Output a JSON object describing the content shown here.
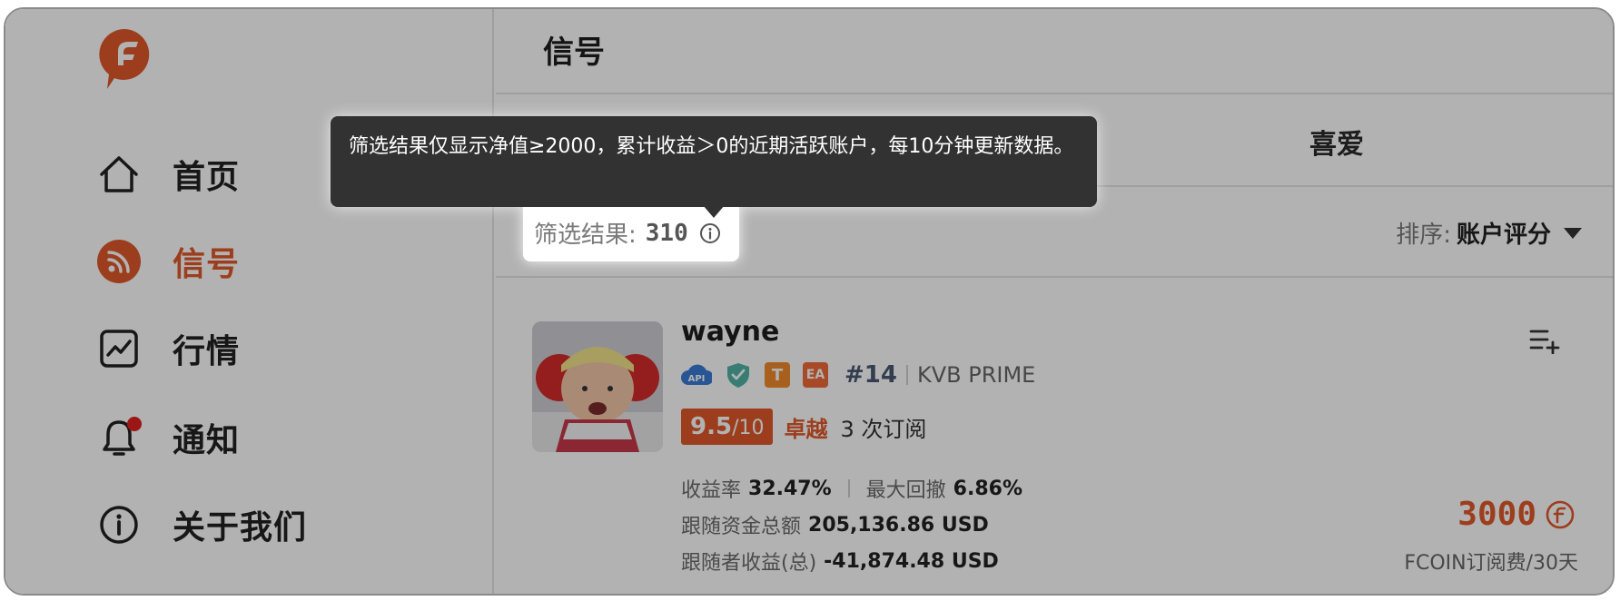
{
  "sidebar": {
    "items": [
      {
        "label": "首页",
        "icon": "home-icon"
      },
      {
        "label": "信号",
        "icon": "rss-icon",
        "active": true
      },
      {
        "label": "行情",
        "icon": "chart-line-icon"
      },
      {
        "label": "通知",
        "icon": "bell-icon",
        "has_dot": true
      },
      {
        "label": "关于我们",
        "icon": "info-icon"
      }
    ]
  },
  "header": {
    "title": "信号"
  },
  "tabs": {
    "favorites_label": "喜爱"
  },
  "filter": {
    "label": "筛选结果:",
    "count": "310"
  },
  "sort": {
    "label": "排序:",
    "value": "账户评分"
  },
  "tooltip": {
    "text": "筛选结果仅显示净值≥2000，累计收益＞0的近期活跃账户，每10分钟更新数据。"
  },
  "signal": {
    "username": "wayne",
    "badges": {
      "api": "API",
      "t": "T",
      "ea": "EA"
    },
    "rank": "#14",
    "broker": "KVB PRIME",
    "score": "9.5",
    "score_max": "/10",
    "grade": "卓越",
    "subscriptions": "3 次订阅",
    "return_label": "收益率",
    "return_value": "32.47%",
    "drawdown_label": "最大回撤",
    "drawdown_value": "6.86%",
    "follow_funds_label": "跟随资金总额",
    "follow_funds_value": "205,136.86 USD",
    "follower_profit_label": "跟随者收益(总)",
    "follower_profit_value": "-41,874.48 USD",
    "price": "3000",
    "price_unit": "FCOIN订阅费/30天"
  },
  "colors": {
    "accent": "#e0592a",
    "overlay": "rgba(0,0,0,0.30)",
    "tooltip_bg": "#323232"
  }
}
